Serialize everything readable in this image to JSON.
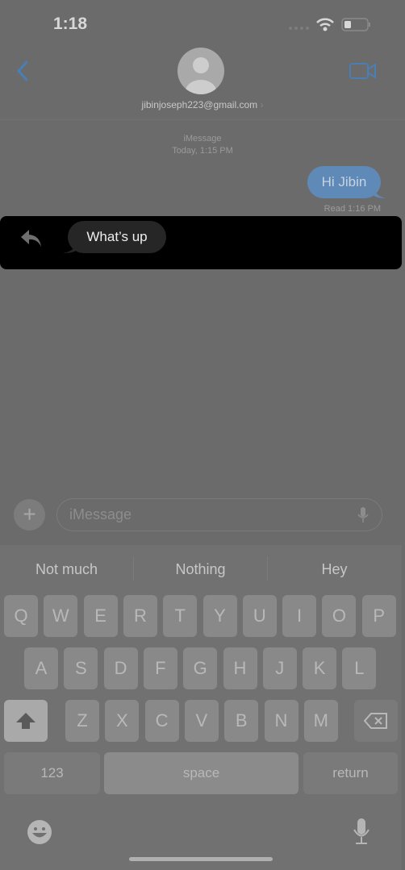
{
  "status_bar": {
    "time": "1:18",
    "battery_level": 0.3
  },
  "header": {
    "contact": "jibinjoseph223@gmail.com",
    "chevron": "›",
    "back_icon": "chevron-left-icon",
    "video_icon": "video-camera-icon",
    "accent": "#4a7fb5"
  },
  "conversation": {
    "service": "iMessage",
    "timestamp": "Today, 1:15 PM",
    "messages": [
      {
        "direction": "outgoing",
        "text": "Hi Jibin",
        "status": "Read 1:16 PM"
      },
      {
        "direction": "incoming",
        "text": "What’s up",
        "highlighted": true
      }
    ]
  },
  "compose": {
    "placeholder": "iMessage",
    "plus": "+"
  },
  "keyboard": {
    "suggestions": [
      "Not much",
      "Nothing",
      "Hey"
    ],
    "row1": [
      "Q",
      "W",
      "E",
      "R",
      "T",
      "Y",
      "U",
      "I",
      "O",
      "P"
    ],
    "row2": [
      "A",
      "S",
      "D",
      "F",
      "G",
      "H",
      "J",
      "K",
      "L"
    ],
    "row3": [
      "Z",
      "X",
      "C",
      "V",
      "B",
      "N",
      "M"
    ],
    "numbers": "123",
    "space": "space",
    "return": "return"
  }
}
